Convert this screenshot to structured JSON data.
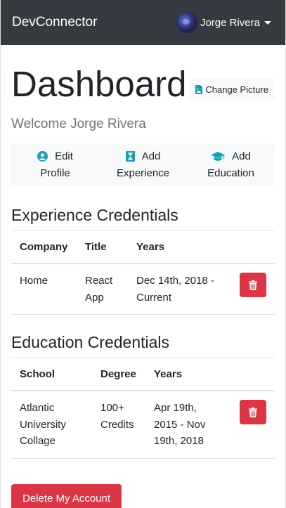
{
  "navbar": {
    "brand": "DevConnector",
    "user_name": "Jorge Rivera"
  },
  "header": {
    "title": "Dashboard",
    "change_picture_label": "Change Picture",
    "welcome": "Welcome Jorge Rivera"
  },
  "actions": {
    "edit_profile": {
      "line1": "Edit",
      "line2": "Profile"
    },
    "add_experience": {
      "line1": "Add",
      "line2": "Experience"
    },
    "add_education": {
      "line1": "Add",
      "line2": "Education"
    }
  },
  "experience": {
    "title": "Experience Credentials",
    "columns": [
      "Company",
      "Title",
      "Years"
    ],
    "rows": [
      {
        "company": "Home",
        "title_line1": "React",
        "title_line2": "App",
        "years_line1": "Dec 14th, 2018 -",
        "years_line2": "Current"
      }
    ]
  },
  "education": {
    "title": "Education Credentials",
    "columns": [
      "School",
      "Degree",
      "Years"
    ],
    "rows": [
      {
        "school_line1": "Atlantic",
        "school_line2": "University",
        "school_line3": "Collage",
        "degree_line1": "100+",
        "degree_line2": "Credits",
        "years_line1": "Apr 19th,",
        "years_line2": "2015 - Nov",
        "years_line3": "19th, 2018"
      }
    ]
  },
  "footer": {
    "delete_account_label": "Delete My Account"
  },
  "colors": {
    "navbar": "#343a40",
    "danger": "#dc3545",
    "info": "#17a2b8",
    "light": "#f8f9fa"
  }
}
